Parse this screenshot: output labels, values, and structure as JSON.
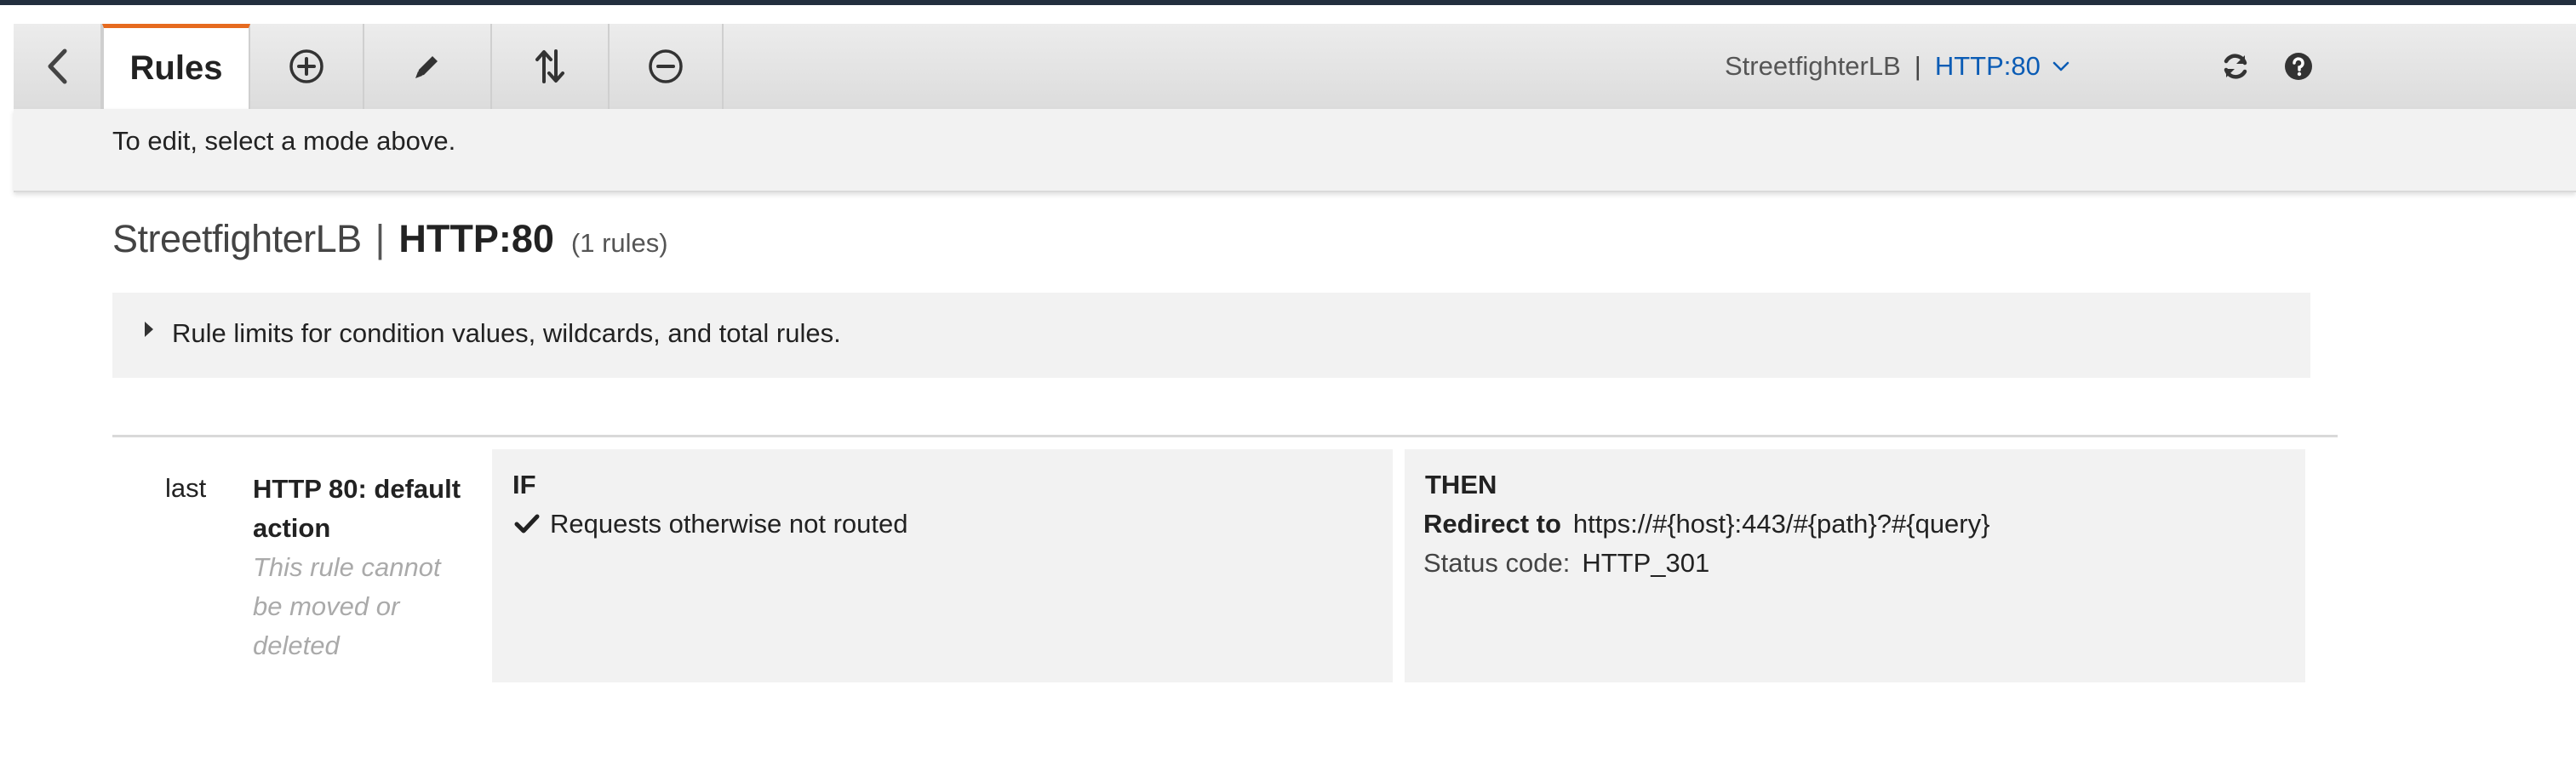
{
  "toolbar": {
    "back_icon": "chevron-left-icon",
    "active_tab": "Rules",
    "tools": [
      {
        "name": "add-rules-button",
        "icon": "plus-circle-icon"
      },
      {
        "name": "edit-rules-button",
        "icon": "pencil-icon"
      },
      {
        "name": "reorder-rules-button",
        "icon": "sort-arrows-icon"
      },
      {
        "name": "delete-rules-button",
        "icon": "minus-circle-icon"
      }
    ],
    "load_balancer": "StreetfighterLB",
    "separator": "|",
    "listener": "HTTP:80",
    "refresh_icon": "refresh-icon",
    "help_icon": "help-icon"
  },
  "info": {
    "message": "To edit, select a mode above."
  },
  "heading": {
    "load_balancer": "StreetfighterLB",
    "separator": "|",
    "listener": "HTTP:80",
    "count": "(1 rules)"
  },
  "limits": {
    "text": "Rule limits for condition values, wildcards, and total rules."
  },
  "rule": {
    "priority": "last",
    "name": "HTTP 80: default action",
    "note": "This rule cannot be moved or deleted",
    "if_heading": "IF",
    "condition": "Requests otherwise not routed",
    "then_heading": "THEN",
    "redirect_label": "Redirect to",
    "redirect_target": "https://#{host}:443/#{path}?#{query}",
    "status_label": "Status code:",
    "status_value": "HTTP_301"
  },
  "colors": {
    "accent_orange": "#e66a1f",
    "link_blue": "#0b5cb5",
    "top_bar": "#232f3e"
  }
}
